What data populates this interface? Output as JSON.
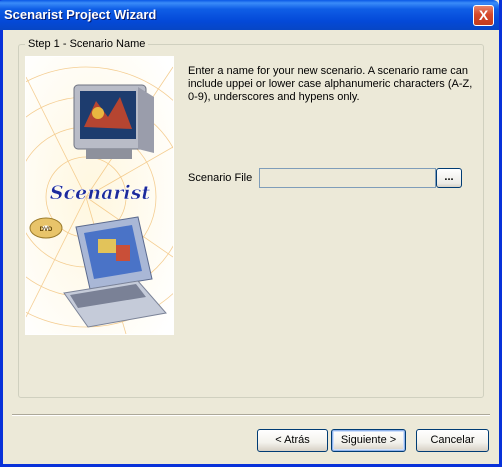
{
  "window": {
    "title": "Scenarist Project Wizard",
    "close_glyph": "X"
  },
  "step": {
    "legend": "Step 1  -  Scenario Name"
  },
  "image": {
    "logo_text": "Scenarist",
    "disc_text": "DVD"
  },
  "instructions": "Enter a name for your new scenario. A scenario rame can include uppei or lower case alphanumeric characters (A-Z, 0-9), underscores and hypens only.",
  "field": {
    "label": "Scenario File",
    "value": "",
    "browse_label": "..."
  },
  "buttons": {
    "back": "< Atrás",
    "next": "Siguiente >",
    "cancel": "Cancelar"
  },
  "colors": {
    "titlebar": "#0449d8",
    "window_bg": "#ece9d8",
    "logo_blue": "#1c2a9c"
  },
  "icons": {
    "close": "close-icon"
  }
}
